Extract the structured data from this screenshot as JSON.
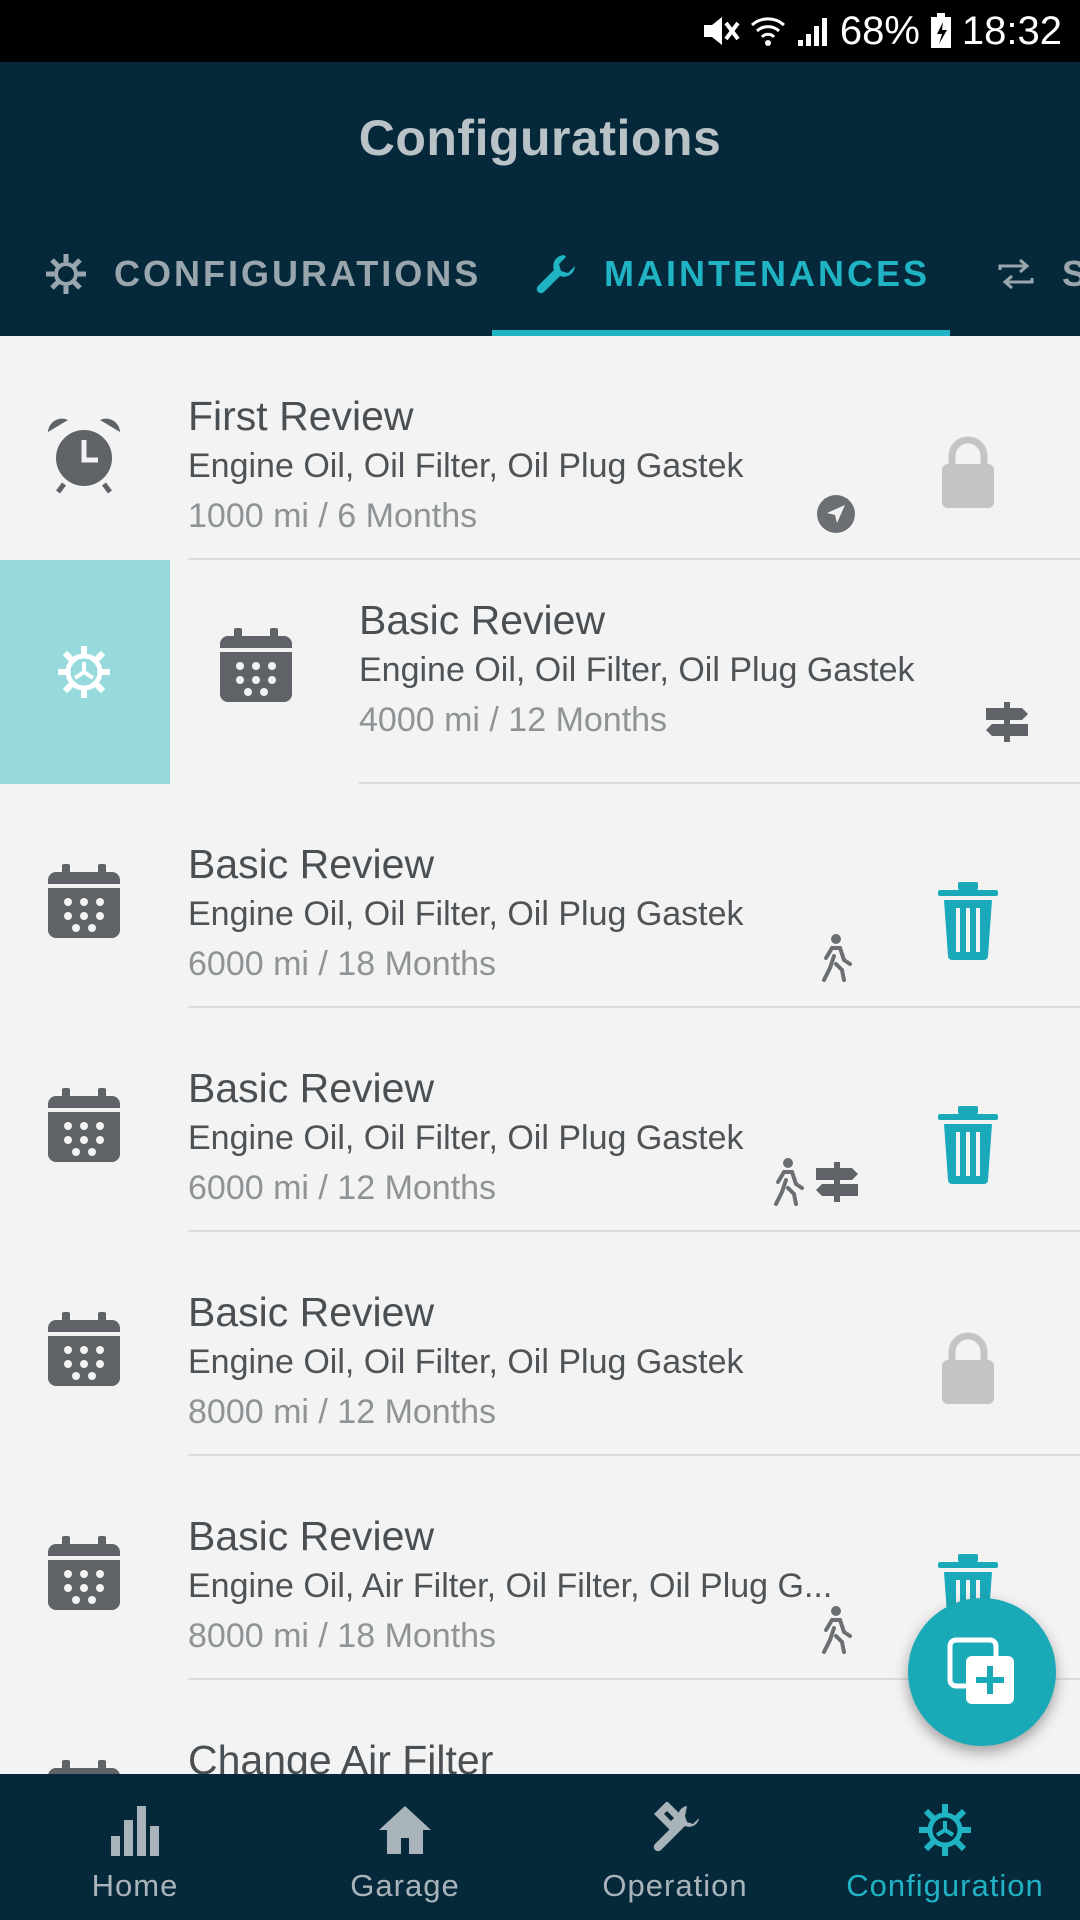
{
  "status_bar": {
    "battery": "68%",
    "time": "18:32"
  },
  "header": {
    "title": "Configurations"
  },
  "tabs": [
    {
      "label": "CONFIGURATIONS",
      "icon": "gear-icon",
      "active": false
    },
    {
      "label": "MAINTENANCES",
      "icon": "wrench-icon",
      "active": true
    },
    {
      "label": "S",
      "icon": "repeat-icon",
      "active": false
    }
  ],
  "maintenances": [
    {
      "title": "First Review",
      "parts": "Engine Oil, Oil Filter, Oil Plug Gastek",
      "interval": "1000 mi / 6 Months",
      "lead_icon": "alarm-clock-icon",
      "badges": [
        "navigation-icon"
      ],
      "trailing": "lock-icon"
    },
    {
      "title": "Basic Review",
      "parts": "Engine Oil, Oil Filter, Oil Plug Gastek",
      "interval": "4000 mi / 12 Months",
      "lead_icon": "calendar-icon",
      "badges": [
        "signpost-icon"
      ],
      "trailing": "none",
      "swipe_action": "gear-icon"
    },
    {
      "title": "Basic Review",
      "parts": "Engine Oil, Oil Filter, Oil Plug Gastek",
      "interval": "6000 mi / 18 Months",
      "lead_icon": "calendar-icon",
      "badges": [
        "walking-icon"
      ],
      "trailing": "trash-icon"
    },
    {
      "title": "Basic Review",
      "parts": "Engine Oil, Oil Filter, Oil Plug Gastek",
      "interval": "6000 mi / 12 Months",
      "lead_icon": "calendar-icon",
      "badges": [
        "walking-icon",
        "signpost-icon"
      ],
      "trailing": "trash-icon"
    },
    {
      "title": "Basic Review",
      "parts": "Engine Oil, Oil Filter, Oil Plug Gastek",
      "interval": "8000 mi / 12 Months",
      "lead_icon": "calendar-icon",
      "badges": [],
      "trailing": "lock-icon"
    },
    {
      "title": "Basic Review",
      "parts": "Engine Oil, Air Filter, Oil Filter, Oil Plug G...",
      "interval": "8000 mi / 18 Months",
      "lead_icon": "calendar-icon",
      "badges": [
        "walking-icon"
      ],
      "trailing": "trash-icon"
    },
    {
      "title": "Change Air Filter",
      "parts": "",
      "interval": "",
      "lead_icon": "calendar-icon",
      "badges": [],
      "trailing": "none"
    }
  ],
  "fab": {
    "icon": "add-copy-icon"
  },
  "bottom_nav": [
    {
      "label": "Home",
      "icon": "bar-chart-icon",
      "active": false
    },
    {
      "label": "Garage",
      "icon": "house-icon",
      "active": false
    },
    {
      "label": "Operation",
      "icon": "tools-icon",
      "active": false
    },
    {
      "label": "Configuration",
      "icon": "gear-icon",
      "active": true
    }
  ],
  "colors": {
    "header_bg": "#05293a",
    "accent": "#1fb3c3",
    "swipe_bg": "#97dade",
    "list_bg": "#f3f3f3"
  }
}
